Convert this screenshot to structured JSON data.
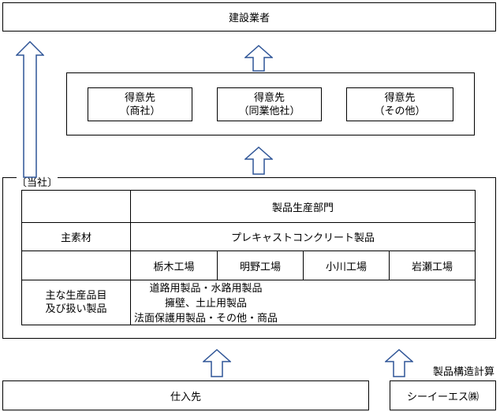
{
  "top_box": {
    "label": "建設業者"
  },
  "customers": [
    {
      "line1": "得意先",
      "line2": "（商社）"
    },
    {
      "line1": "得意先",
      "line2": "（同業他社）"
    },
    {
      "line1": "得意先",
      "line2": "（その他）"
    }
  ],
  "company": {
    "label": "〔当社〕",
    "dept_header": "製品生産部門",
    "main_material_label": "主素材",
    "main_material_value": "プレキャストコンクリート製品",
    "factories": [
      "栃木工場",
      "明野工場",
      "小川工場",
      "岩瀬工場"
    ],
    "products_label_line1": "主な生産品目",
    "products_label_line2": "及び扱い製品",
    "products": [
      "道路用製品・水路用製品",
      "擁壁、土止用製品",
      "法面保護用製品・その他・商品"
    ]
  },
  "bottom": {
    "supplier": "仕入先",
    "partner_note": "製品構造計算",
    "partner": "シーイーエス㈱"
  }
}
